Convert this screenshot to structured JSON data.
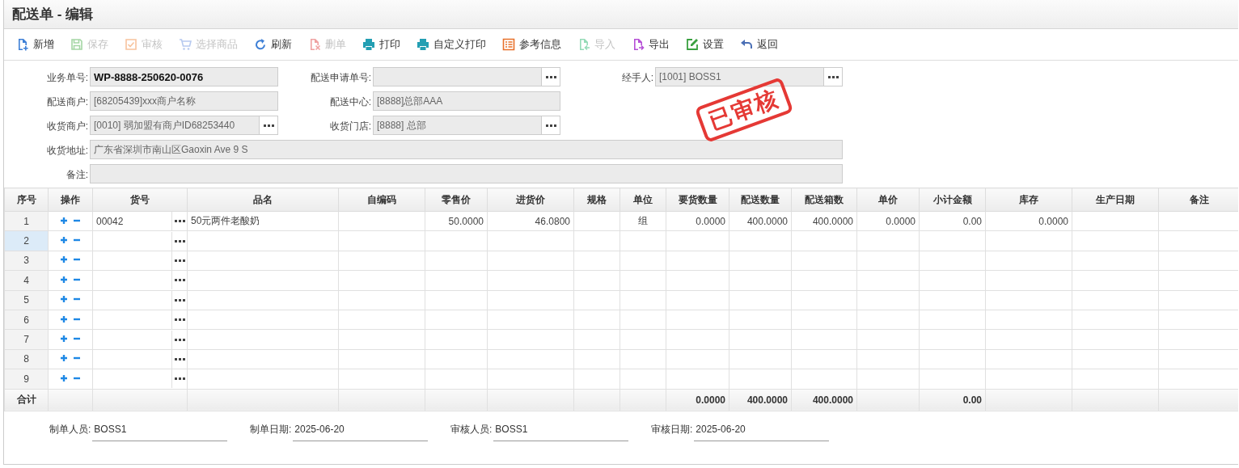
{
  "window": {
    "title": "配送单 - 编辑"
  },
  "toolbar": [
    {
      "label": "新增",
      "kind": "add",
      "disabled": false
    },
    {
      "label": "保存",
      "kind": "save",
      "disabled": true
    },
    {
      "label": "审核",
      "kind": "approve",
      "disabled": true
    },
    {
      "label": "选择商品",
      "kind": "cart",
      "disabled": true
    },
    {
      "label": "刷新",
      "kind": "refresh",
      "disabled": false
    },
    {
      "label": "删单",
      "kind": "delete",
      "disabled": true
    },
    {
      "label": "打印",
      "kind": "print",
      "disabled": false
    },
    {
      "label": "自定义打印",
      "kind": "print",
      "disabled": false
    },
    {
      "label": "参考信息",
      "kind": "info",
      "disabled": false
    },
    {
      "label": "导入",
      "kind": "import",
      "disabled": true
    },
    {
      "label": "导出",
      "kind": "export",
      "disabled": false
    },
    {
      "label": "设置",
      "kind": "settings",
      "disabled": false
    },
    {
      "label": "返回",
      "kind": "back",
      "disabled": false
    }
  ],
  "form": {
    "rows": [
      [
        {
          "label": "业务单号:",
          "value": "WP-8888-250620-0076",
          "bold": true
        },
        {
          "label": "配送申请单号:",
          "picker": true
        },
        {
          "label": "经手人:",
          "value": "[1001] BOSS1",
          "picker": true
        }
      ],
      [
        {
          "label": "配送商户:",
          "value": "[68205439]xxx商户名称"
        },
        {
          "label": "配送中心:",
          "value": "[8888]总部AAA"
        }
      ],
      [
        {
          "label": "收货商户:",
          "value": "[0010] 弱加盟有商户ID68253440",
          "picker": true
        },
        {
          "label": "收货门店:",
          "value": "[8888] 总部",
          "picker": true
        }
      ],
      [
        {
          "label": "收货地址:",
          "value": "广东省深圳市南山区Gaoxin Ave 9 S"
        }
      ],
      [
        {
          "label": "备注:"
        }
      ]
    ],
    "stamp": "已审核"
  },
  "table": {
    "columns": [
      "序号",
      "操作",
      "货号",
      "品名",
      "自编码",
      "零售价",
      "进货价",
      "规格",
      "单位",
      "要货数量",
      "配送数量",
      "配送箱数",
      "单价",
      "小计金额",
      "库存",
      "生产日期",
      "备注"
    ],
    "rows": [
      {
        "no": "1",
        "selected": false,
        "item_code": "00042",
        "name": "50元两件老酸奶",
        "retail_price": "50.0000",
        "purchase_price": "46.0800",
        "unit": "组",
        "req_qty": "0.0000",
        "qty": "400.0000",
        "boxes": "400.0000",
        "unit_price": "0.0000",
        "subtotal": "0.00",
        "stock": "0.0000"
      },
      {
        "no": "2",
        "selected": true
      },
      {
        "no": "3",
        "selected": false
      },
      {
        "no": "4",
        "selected": false
      },
      {
        "no": "5",
        "selected": false
      },
      {
        "no": "6",
        "selected": false
      },
      {
        "no": "7",
        "selected": false
      },
      {
        "no": "8",
        "selected": false
      },
      {
        "no": "9",
        "selected": false
      }
    ],
    "totals": {
      "label": "合计",
      "req_qty": "0.0000",
      "qty": "400.0000",
      "boxes": "400.0000",
      "subtotal": "0.00"
    }
  },
  "footer": [
    {
      "label": "制单人员:",
      "value": "BOSS1"
    },
    {
      "label": "制单日期:",
      "value": "2025-06-20"
    },
    {
      "label": "审核人员:",
      "value": "BOSS1"
    },
    {
      "label": "审核日期:",
      "value": "2025-06-20"
    }
  ]
}
